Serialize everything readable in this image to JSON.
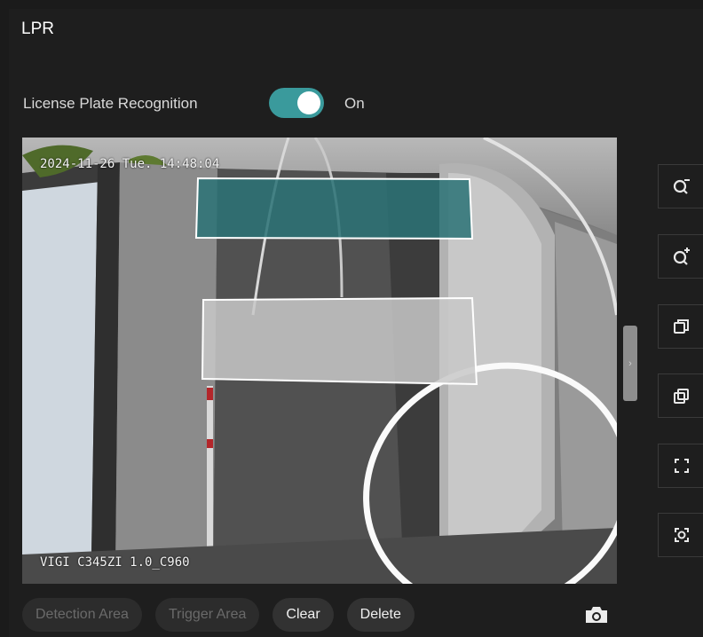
{
  "header": {
    "title": "LPR"
  },
  "lpr": {
    "label": "License Plate Recognition",
    "state_text": "On",
    "enabled": true,
    "accent": "#3a9a9c"
  },
  "video": {
    "timestamp": "2024-11-26 Tue. 14:48:04",
    "model": "VIGI C345ZI 1.0_C960",
    "detection_area_color": "#2a7276",
    "trigger_area_color": "#c8c8c8"
  },
  "side_tools": [
    {
      "name": "zoom-out-icon"
    },
    {
      "name": "zoom-in-icon"
    },
    {
      "name": "restore-icon"
    },
    {
      "name": "window-icon"
    },
    {
      "name": "fullscreen-icon"
    },
    {
      "name": "focus-icon"
    }
  ],
  "actions": {
    "detection_area": "Detection Area",
    "trigger_area": "Trigger Area",
    "clear": "Clear",
    "delete": "Delete"
  }
}
